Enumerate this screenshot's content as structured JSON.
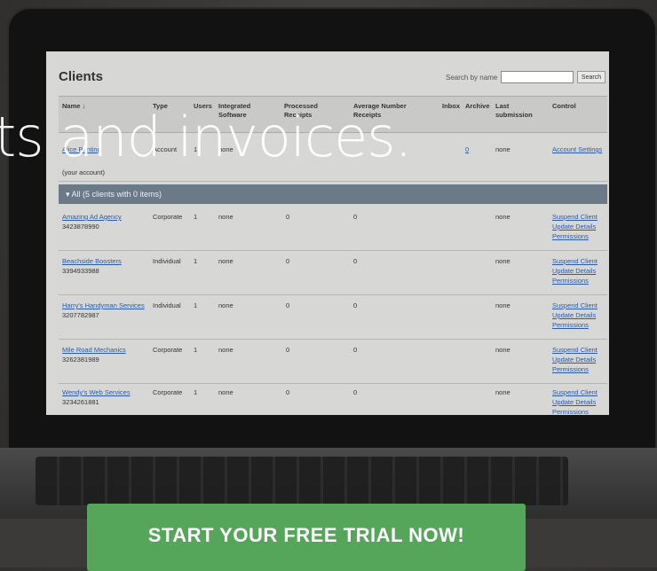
{
  "hero": {
    "headline": "ts and invoices.",
    "cta_label": "START YOUR FREE TRIAL NOW!"
  },
  "app": {
    "title": "Clients",
    "search": {
      "label": "Search by name",
      "value": "",
      "button": "Search"
    },
    "columns": {
      "name": "Name ↓",
      "type": "Type",
      "users": "Users",
      "integrated": "Integrated Software",
      "processed": "Processed Receipts",
      "average": "Average Number Receipts",
      "inbox": "Inbox",
      "archive": "Archive",
      "last": "Last submission",
      "control": "Control"
    },
    "own_account": {
      "name": "Alice Printing",
      "sub": "(your account)",
      "type": "Account",
      "users": "1",
      "integrated": "none",
      "archive": "0",
      "last": "none",
      "control": "Account Settings"
    },
    "group_label": "▾  All (5 clients with 0 items)",
    "rows": [
      {
        "name": "Amazing Ad Agency",
        "id": "3423878990",
        "type": "Corporate",
        "users": "1",
        "integrated": "none",
        "processed": "0",
        "average": "0",
        "last": "none"
      },
      {
        "name": "Beachside Boosters",
        "id": "3394933988",
        "type": "Individual",
        "users": "1",
        "integrated": "none",
        "processed": "0",
        "average": "0",
        "last": "none"
      },
      {
        "name": "Harry's Handyman Services",
        "id": "3207782987",
        "type": "Individual",
        "users": "1",
        "integrated": "none",
        "processed": "0",
        "average": "0",
        "last": "none"
      },
      {
        "name": "Mile Road Mechanics",
        "id": "3262381989",
        "type": "Corporate",
        "users": "1",
        "integrated": "none",
        "processed": "0",
        "average": "0",
        "last": "none"
      },
      {
        "name": "Wendy's Web Services",
        "id": "3234261881",
        "type": "Corporate",
        "users": "1",
        "integrated": "none",
        "processed": "0",
        "average": "0",
        "last": "none"
      }
    ],
    "actions": {
      "suspend": "Suspend Client",
      "update": "Update Details",
      "permissions": "Permissions"
    }
  }
}
